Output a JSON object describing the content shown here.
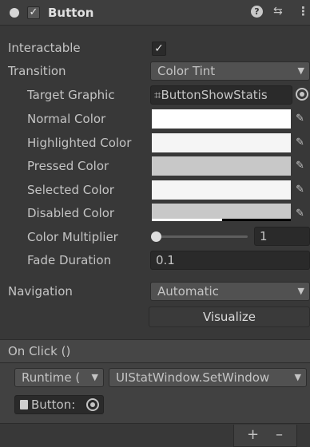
{
  "header": {
    "enabled_mark": "✓",
    "title": "Button",
    "help_icon": "?",
    "presets_icon": "⇆",
    "menu_icon": "⋮"
  },
  "properties": {
    "interactable": {
      "label": "Interactable",
      "checked_mark": "✓"
    },
    "transition": {
      "label": "Transition",
      "value": "Color Tint"
    },
    "target_graphic": {
      "label": "Target Graphic",
      "icon": "⌗",
      "value": "ButtonShowStatis"
    },
    "normal_color": {
      "label": "Normal Color",
      "color": "#ffffff"
    },
    "highlighted_color": {
      "label": "Highlighted Color",
      "color": "#f5f5f5"
    },
    "pressed_color": {
      "label": "Pressed Color",
      "color": "#c8c8c8"
    },
    "selected_color": {
      "label": "Selected Color",
      "color": "#f5f5f5"
    },
    "disabled_color": {
      "label": "Disabled Color",
      "color": "#c8c8c8"
    },
    "color_multiplier": {
      "label": "Color Multiplier",
      "value": "1",
      "slider_fraction": 0
    },
    "fade_duration": {
      "label": "Fade Duration",
      "value": "0.1"
    },
    "navigation": {
      "label": "Navigation",
      "value": "Automatic"
    },
    "visualize": {
      "label": "Visualize"
    }
  },
  "on_click": {
    "header": "On Click ()",
    "runtime_dropdown": "Runtime (",
    "function_dropdown": "UIStatWindow.SetWindow",
    "target_object": "Button:",
    "add_label": "+",
    "remove_label": "–"
  },
  "colors": {
    "panel_bg": "#383838",
    "field_bg": "#2a2a2a",
    "dropdown_bg": "#515151",
    "text": "#c4c4c4",
    "alpha_bar": "#ffffff"
  }
}
